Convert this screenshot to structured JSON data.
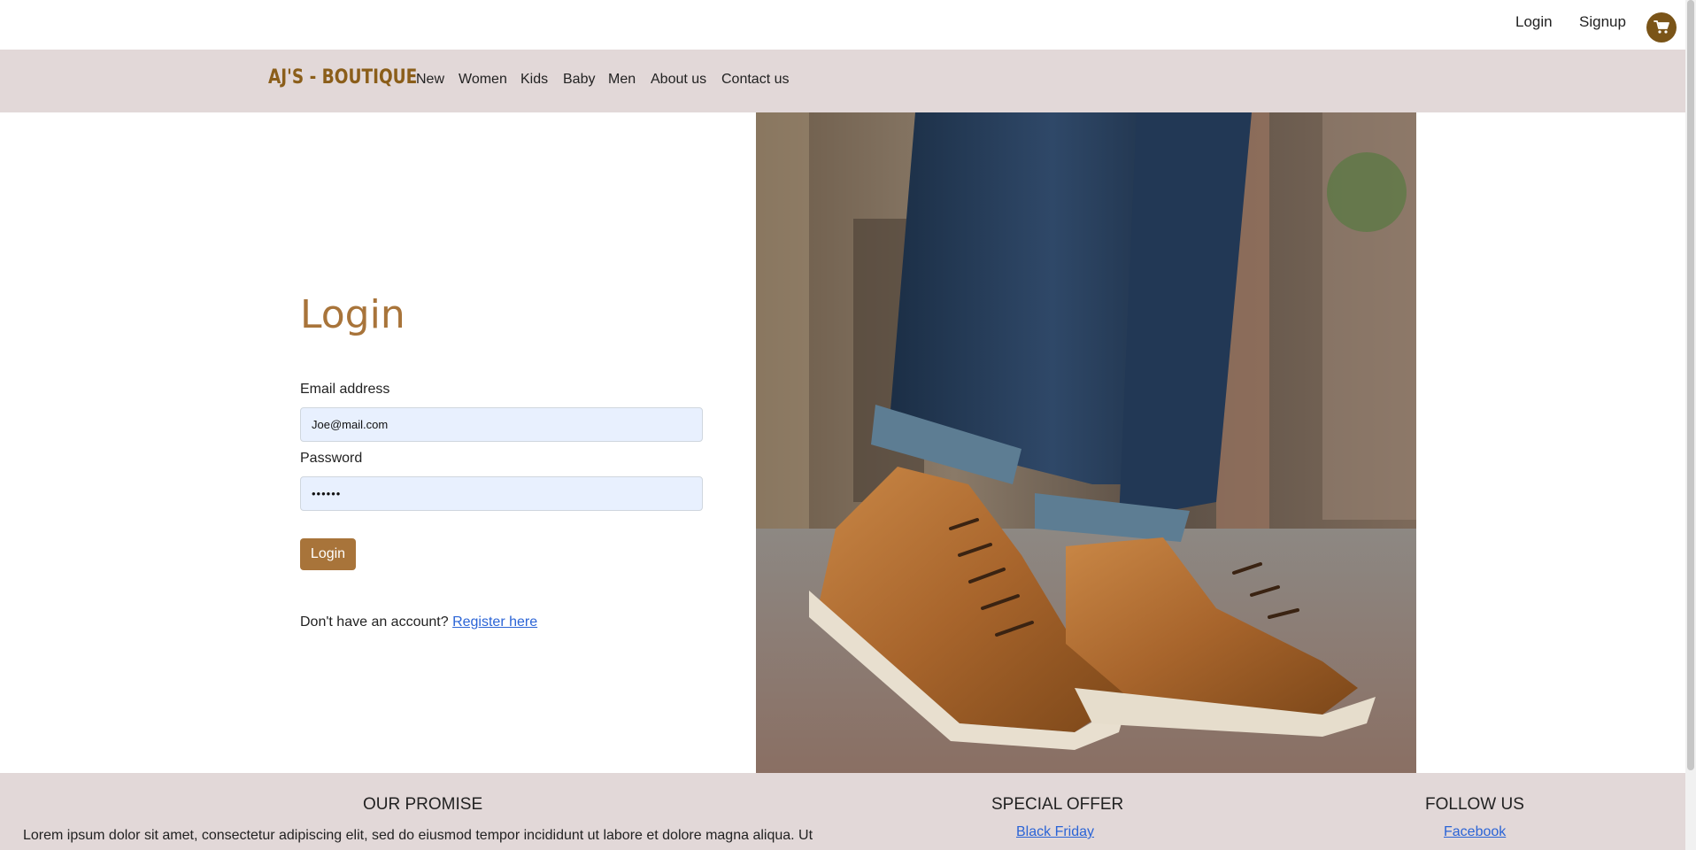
{
  "topbar": {
    "login_label": "Login",
    "signup_label": "Signup",
    "cart_icon": "cart-icon"
  },
  "navbar": {
    "brand": "AJ'S - BOUTIQUE",
    "items": [
      "New",
      "Women",
      "Kids",
      "Baby",
      "Men",
      "About us",
      "Contact us"
    ]
  },
  "login_form": {
    "title": "Login",
    "email_label": "Email address",
    "email_value": "Joe@mail.com",
    "password_label": "Password",
    "password_value": "••••••",
    "submit_label": "Login",
    "register_prompt": "Don't have an account?",
    "register_link": "Register here"
  },
  "footer": {
    "promise_heading": "OUR PROMISE",
    "promise_text": "Lorem ipsum dolor sit amet, consectetur adipiscing elit, sed do eiusmod tempor incididunt ut labore et dolore magna aliqua. Ut",
    "offer_heading": "SPECIAL OFFER",
    "offer_link": "Black Friday",
    "follow_heading": "FOLLOW US",
    "follow_link": "Facebook"
  },
  "colors": {
    "accent": "#a8743a",
    "brand": "#8b5e1a",
    "nav_bg": "#e2d8d8",
    "link": "#2b64d6",
    "input_bg": "#e8f0fe"
  }
}
